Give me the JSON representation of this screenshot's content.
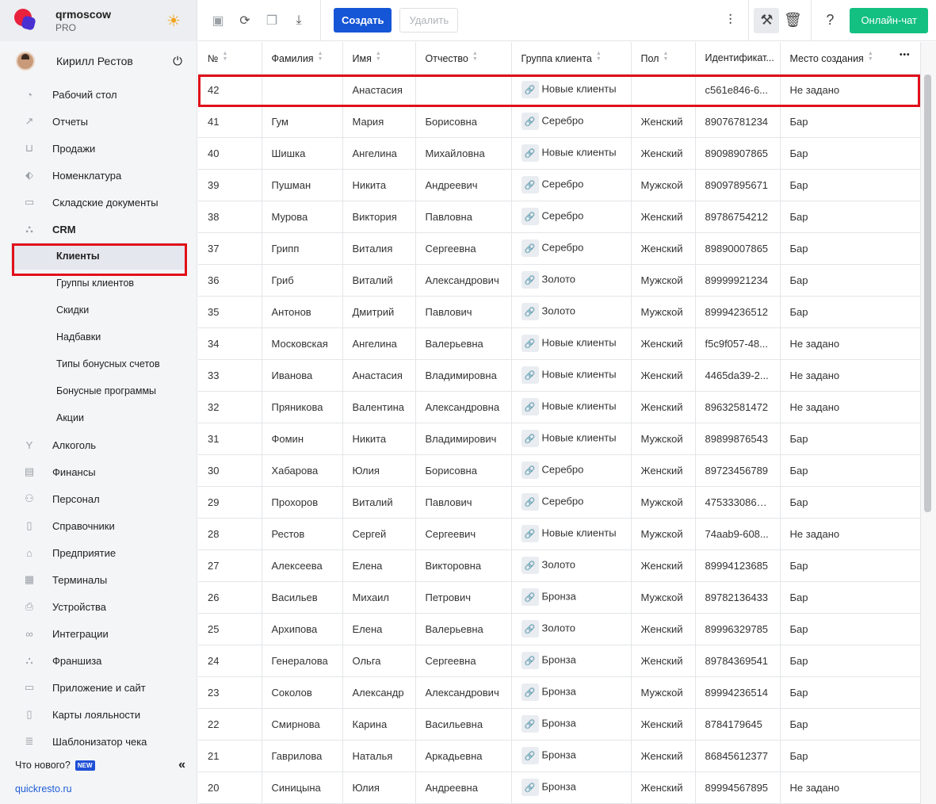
{
  "brand": {
    "name": "qrmoscow",
    "plan": "PRO"
  },
  "user": {
    "name": "Кирилл Рестов"
  },
  "menu": [
    {
      "label": "Рабочий стол",
      "icon": "dashboard-icon"
    },
    {
      "label": "Отчеты",
      "icon": "chart-icon"
    },
    {
      "label": "Продажи",
      "icon": "basket-icon"
    },
    {
      "label": "Номенклатура",
      "icon": "tag-icon"
    },
    {
      "label": "Складские документы",
      "icon": "archive-icon"
    },
    {
      "label": "CRM",
      "icon": "hierarchy-icon"
    }
  ],
  "crm_sub": [
    "Клиенты",
    "Группы клиентов",
    "Скидки",
    "Надбавки",
    "Типы бонусных счетов",
    "Бонусные программы",
    "Акции"
  ],
  "menu2": [
    {
      "label": "Алкоголь",
      "icon": "glass-icon"
    },
    {
      "label": "Финансы",
      "icon": "wallet-icon"
    },
    {
      "label": "Персонал",
      "icon": "people-icon"
    },
    {
      "label": "Справочники",
      "icon": "book-icon"
    },
    {
      "label": "Предприятие",
      "icon": "store-icon"
    },
    {
      "label": "Терминалы",
      "icon": "qr-icon"
    },
    {
      "label": "Устройства",
      "icon": "printer-icon"
    },
    {
      "label": "Интеграции",
      "icon": "infinity-icon"
    },
    {
      "label": "Франшиза",
      "icon": "hierarchy-icon"
    },
    {
      "label": "Приложение и сайт",
      "icon": "monitor-icon"
    },
    {
      "label": "Карты лояльности",
      "icon": "card-icon"
    },
    {
      "label": "Шаблонизатор чека",
      "icon": "receipt-icon"
    }
  ],
  "footer": {
    "news": "Что нового?",
    "badge": "NEW",
    "link": "quickresto.ru"
  },
  "toolbar": {
    "create": "Создать",
    "delete": "Удалить",
    "chat": "Онлайн-чат"
  },
  "table": {
    "columns": [
      "№",
      "Фамилия",
      "Имя",
      "Отчество",
      "Группа клиента",
      "Пол",
      "Идентификат...",
      "Место создания"
    ],
    "rows": [
      [
        "42",
        "",
        "Анастасия",
        "",
        "Новые клиенты",
        "",
        "c561e846-6...",
        "Не задано"
      ],
      [
        "41",
        "Гум",
        "Мария",
        "Борисовна",
        "Серебро",
        "Женский",
        "89076781234",
        "Бар"
      ],
      [
        "40",
        "Шишка",
        "Ангелина",
        "Михайловна",
        "Новые клиенты",
        "Женский",
        "89098907865",
        "Бар"
      ],
      [
        "39",
        "Пушман",
        "Никита",
        "Андреевич",
        "Серебро",
        "Мужской",
        "89097895671",
        "Бар"
      ],
      [
        "38",
        "Мурова",
        "Виктория",
        "Павловна",
        "Серебро",
        "Женский",
        "89786754212",
        "Бар"
      ],
      [
        "37",
        "Грипп",
        "Виталия",
        "Сергеевна",
        "Серебро",
        "Женский",
        "89890007865",
        "Бар"
      ],
      [
        "36",
        "Гриб",
        "Виталий",
        "Александрович",
        "Золото",
        "Мужской",
        "89999921234",
        "Бар"
      ],
      [
        "35",
        "Антонов",
        "Дмитрий",
        "Павлович",
        "Золото",
        "Мужской",
        "89994236512",
        "Бар"
      ],
      [
        "34",
        "Московская",
        "Ангелина",
        "Валерьевна",
        "Новые клиенты",
        "Женский",
        "f5c9f057-48...",
        "Не задано"
      ],
      [
        "33",
        "Иванова",
        "Анастасия",
        "Владимировна",
        "Новые клиенты",
        "Женский",
        "4465da39-2...",
        "Не задано"
      ],
      [
        "32",
        "Пряникова",
        "Валентина",
        "Александровна",
        "Новые клиенты",
        "Женский",
        "89632581472",
        "Не задано"
      ],
      [
        "31",
        "Фомин",
        "Никита",
        "Владимирович",
        "Новые клиенты",
        "Мужской",
        "89899876543",
        "Бар"
      ],
      [
        "30",
        "Хабарова",
        "Юлия",
        "Борисовна",
        "Серебро",
        "Женский",
        "89723456789",
        "Бар"
      ],
      [
        "29",
        "Прохоров",
        "Виталий",
        "Павлович",
        "Серебро",
        "Мужской",
        "4753330861...",
        "Бар"
      ],
      [
        "28",
        "Рестов",
        "Сергей",
        "Сергеевич",
        "Новые клиенты",
        "Мужской",
        "74aab9-608...",
        "Не задано"
      ],
      [
        "27",
        "Алексеева",
        "Елена",
        "Викторовна",
        "Золото",
        "Женский",
        "89994123685",
        "Бар"
      ],
      [
        "26",
        "Васильев",
        "Михаил",
        "Петрович",
        "Бронза",
        "Мужской",
        "89782136433",
        "Бар"
      ],
      [
        "25",
        "Архипова",
        "Елена",
        "Валерьевна",
        "Золото",
        "Женский",
        "89996329785",
        "Бар"
      ],
      [
        "24",
        "Генералова",
        "Ольга",
        "Сергеевна",
        "Бронза",
        "Женский",
        "89784369541",
        "Бар"
      ],
      [
        "23",
        "Соколов",
        "Александр",
        "Александрович",
        "Бронза",
        "Мужской",
        "89994236514",
        "Бар"
      ],
      [
        "22",
        "Смирнова",
        "Карина",
        "Васильевна",
        "Бронза",
        "Женский",
        "8784179645",
        "Бар"
      ],
      [
        "21",
        "Гаврилова",
        "Наталья",
        "Аркадьевна",
        "Бронза",
        "Женский",
        "86845612377",
        "Бар"
      ],
      [
        "20",
        "Синицына",
        "Юлия",
        "Андреевна",
        "Бронза",
        "Женский",
        "89994567895",
        "Не задано"
      ]
    ]
  }
}
